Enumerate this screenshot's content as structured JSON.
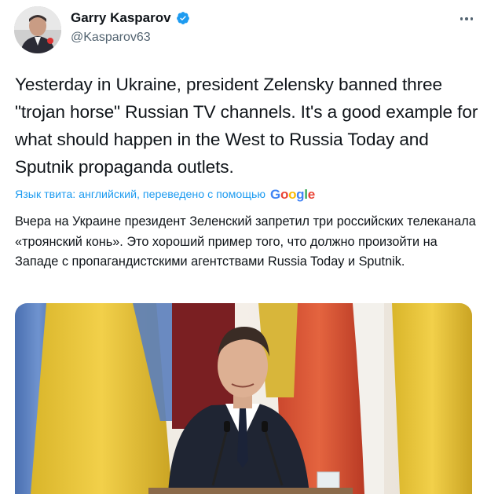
{
  "author": {
    "name": "Garry Kasparov",
    "handle": "@Kasparov63",
    "verified": true,
    "verified_color": "#1d9bf0",
    "avatar_icon": "user-avatar-photo"
  },
  "tweet": {
    "text": "Yesterday in Ukraine, president Zelensky banned three \"trojan horse\" Russian TV channels. It's a good example for what should happen in the West to Russia Today and Sputnik propaganda outlets."
  },
  "translation": {
    "label": "Язык твита: английский, переведено с помощью",
    "provider": "Google",
    "text": "Вчера на Украине президент Зеленский запретил три российских телеканала «троянский конь». Это хороший пример того, что должно произойти на Западе с пропагандистскими агентствами Russia Today и Sputnik."
  },
  "media": {
    "icon": "photo-zelensky-at-podium"
  },
  "icons": {
    "more": "more-options-icon",
    "verified": "verified-badge-icon"
  },
  "colors": {
    "link_blue": "#1d9bf0",
    "text": "#0f1419",
    "secondary": "#536471"
  }
}
